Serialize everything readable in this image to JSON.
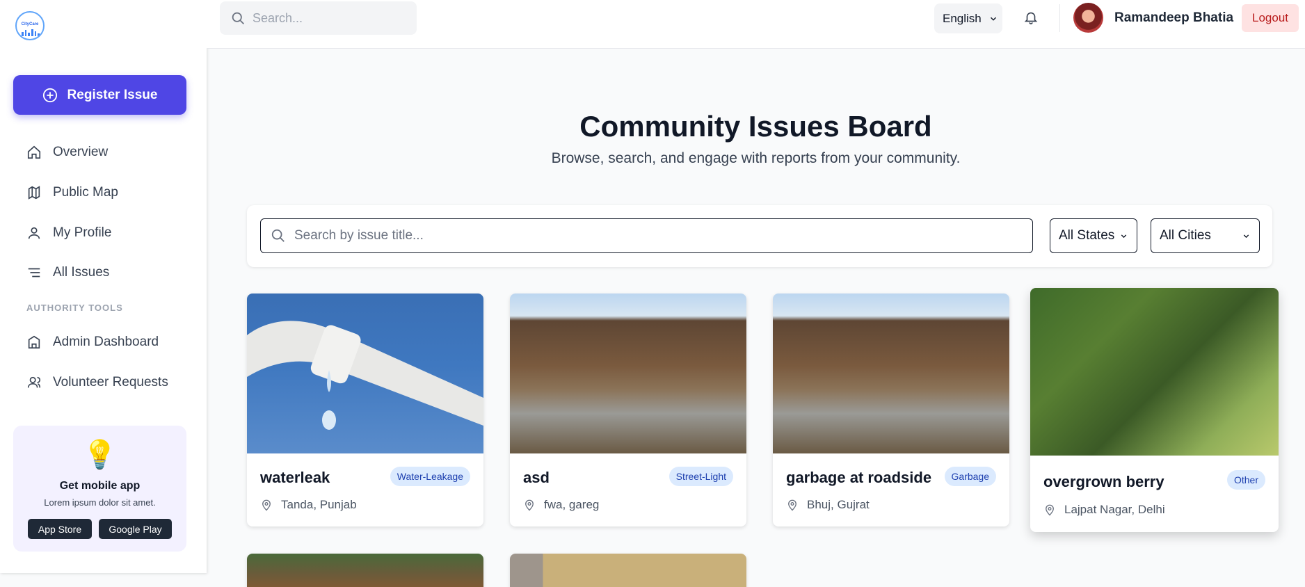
{
  "app": {
    "logo_text": "CityCare"
  },
  "sidebar": {
    "register_label": "Register Issue",
    "items": [
      {
        "label": "Overview",
        "icon": "home-icon"
      },
      {
        "label": "Public Map",
        "icon": "map-icon"
      },
      {
        "label": "My Profile",
        "icon": "user-icon"
      },
      {
        "label": "All Issues",
        "icon": "list-icon"
      }
    ],
    "section_label": "AUTHORITY TOOLS",
    "authority_items": [
      {
        "label": "Admin Dashboard",
        "icon": "building-icon"
      },
      {
        "label": "Volunteer Requests",
        "icon": "users-icon"
      }
    ],
    "promo": {
      "icon": "lightbulb-icon",
      "title": "Get mobile app",
      "desc": "Lorem ipsum dolor sit amet.",
      "app_store": "App Store",
      "google_play": "Google Play"
    }
  },
  "header": {
    "search_placeholder": "Search...",
    "language": "English",
    "user_name": "Ramandeep Bhatia",
    "logout": "Logout"
  },
  "main": {
    "title": "Community Issues Board",
    "subtitle": "Browse, search, and engage with reports from your community.",
    "issue_search_placeholder": "Search by issue title...",
    "state_filter": "All States",
    "city_filter": "All Cities",
    "issues": [
      {
        "title": "waterleak",
        "category": "Water-Leakage",
        "location": "Tanda, Punjab"
      },
      {
        "title": "asd",
        "category": "Street-Light",
        "location": "fwa, gareg"
      },
      {
        "title": "garbage at roadside",
        "category": "Garbage",
        "location": "Bhuj, Gujrat"
      },
      {
        "title": "overgrown berry",
        "category": "Other",
        "location": "Lajpat Nagar, Delhi"
      }
    ]
  },
  "colors": {
    "primary": "#4f46e5",
    "badge_bg": "#dbeafe",
    "badge_text": "#1e40af",
    "logout_bg": "#fee2e2",
    "logout_text": "#b91c1c"
  }
}
